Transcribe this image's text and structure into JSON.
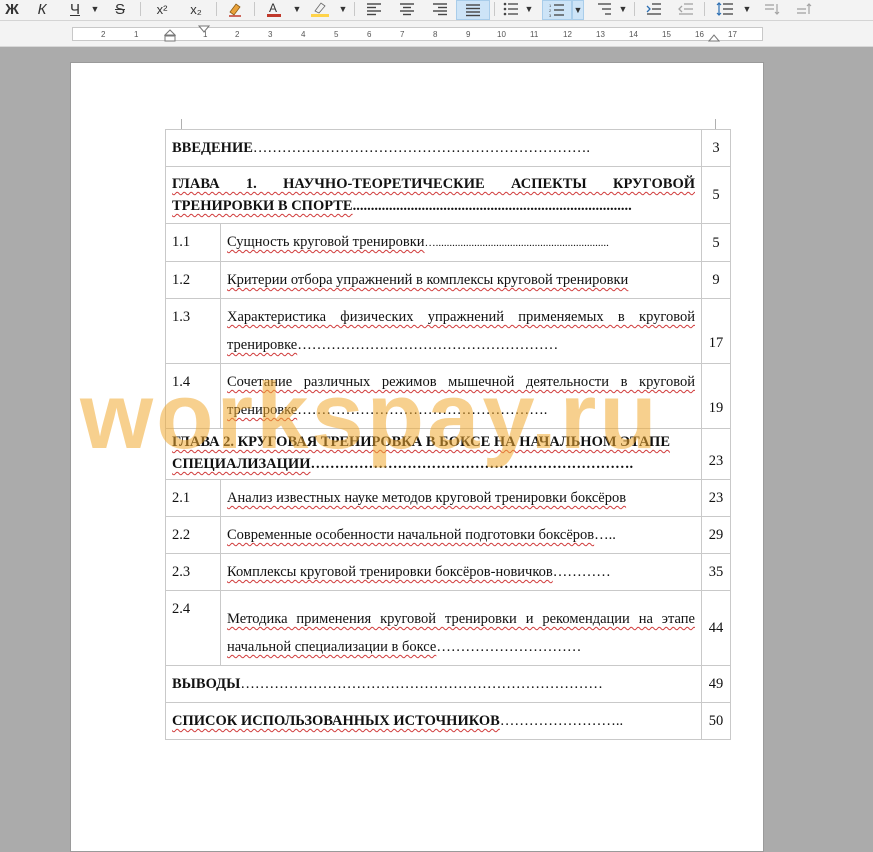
{
  "toolbar": {
    "bold_glyph": "Ж",
    "italic_glyph": "К",
    "underline_glyph": "Ч",
    "strike_glyph": "S",
    "superscript_label": "x²",
    "subscript_label": "x₂",
    "font_color": "#c0392b",
    "highlight_color": "#ffd34a"
  },
  "ruler": {
    "numbers": [
      "2",
      "1",
      "1",
      "2",
      "3",
      "4",
      "5",
      "6",
      "7",
      "8",
      "9",
      "10",
      "11",
      "12",
      "13",
      "14",
      "15",
      "16",
      "17"
    ]
  },
  "toc": {
    "rows": [
      {
        "num": "",
        "title": "ВВЕДЕНИЕ",
        "leader": "…………………………………………………………….",
        "page": "3"
      },
      {
        "num": "",
        "title": "ГЛАВА 1. НАУЧНО-ТЕОРЕТИЧЕСКИЕ АСПЕКТЫ КРУГОВОЙ ТРЕНИРОВКИ В СПОРТЕ",
        "leader": ".............................................................................",
        "page": "5"
      },
      {
        "num": "1.1",
        "title": "Сущность круговой тренировки",
        "leader": "…...............................................................",
        "page": "5"
      },
      {
        "num": "1.2",
        "title": "Критерии отбора упражнений в комплексы круговой тренировки",
        "leader": "",
        "page": "9"
      },
      {
        "num": "1.3",
        "title": "Характеристика физических упражнений применяемых в круговой тренировке",
        "leader": "………………………………………………",
        "page": "17"
      },
      {
        "num": "1.4",
        "title": "Сочетание различных режимов мышечной деятельности в круговой тренировке",
        "leader": "…………………………………………….",
        "page": "19"
      },
      {
        "num": "",
        "title": "ГЛАВА 2. КРУГОВАЯ ТРЕНИРОВКА В БОКСЕ НА НАЧАЛЬНОМ ЭТАПЕ СПЕЦИАЛИЗАЦИИ",
        "leader": "………………………………………………………….",
        "page": "23"
      },
      {
        "num": "2.1",
        "title": "Анализ известных науке методов круговой тренировки боксёров",
        "leader": "",
        "page": "23"
      },
      {
        "num": "2.2",
        "title": "Современные особенности начальной подготовки боксёров",
        "leader": "…..",
        "page": "29"
      },
      {
        "num": "2.3",
        "title": "Комплексы круговой тренировки боксёров-новичков",
        "leader": "…………",
        "page": "35"
      },
      {
        "num": "2.4",
        "title": "Методика применения круговой тренировки и рекомендации на этапе начальной специализации в боксе",
        "leader": "…………………………",
        "page": "44"
      },
      {
        "num": "",
        "title": "ВЫВОДЫ",
        "leader": "…………………………………………………………………",
        "page": "49"
      },
      {
        "num": "",
        "title": "СПИСОК ИСПОЛЬЗОВАННЫХ ИСТОЧНИКОВ",
        "leader": "……………………..",
        "page": "50"
      }
    ]
  },
  "watermark": "workspay.ru"
}
